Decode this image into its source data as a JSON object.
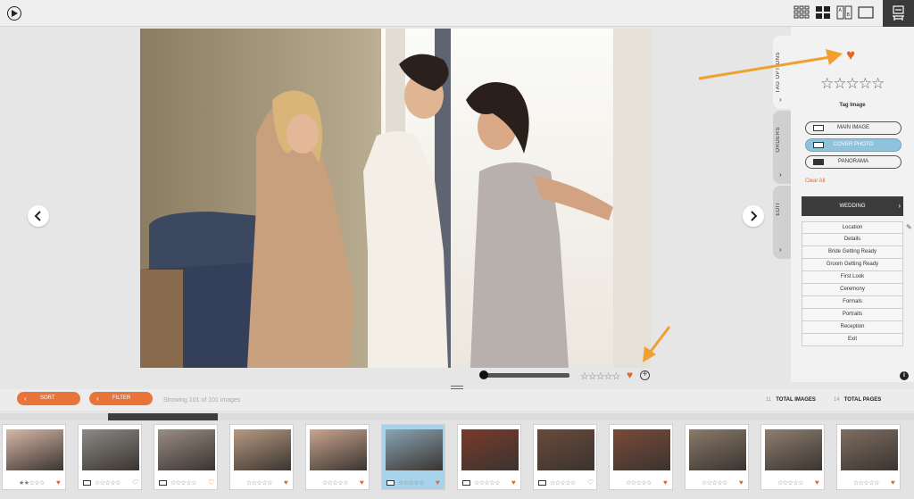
{
  "toolbar_top": {
    "play_icon": "play-circle-icon",
    "view_modes": [
      "grid-view-icon",
      "four-up-view-icon",
      "compare-ab-icon",
      "single-view-icon"
    ],
    "account_icon": "account-icon"
  },
  "main_image": {
    "rating_stars": 0,
    "favorited": true
  },
  "side_tabs": [
    {
      "label": "TAG OPTIONS",
      "active": true
    },
    {
      "label": "ORDERS",
      "active": false
    },
    {
      "label": "EDIT",
      "active": false
    }
  ],
  "tag_panel": {
    "tag_label": "Tag Image",
    "buttons": [
      {
        "label": "MAIN IMAGE",
        "selected": false
      },
      {
        "label": "COVER PHOTO",
        "selected": true
      },
      {
        "label": "PANORAMA",
        "selected": false
      }
    ],
    "clear_all": "Clear All",
    "category": "WEDDING",
    "subcategories": [
      "Location",
      "Details",
      "Bride Getting Ready",
      "Groom Getting Ready",
      "First Look",
      "Ceremony",
      "Formals",
      "Portraits",
      "Reception",
      "Exit"
    ]
  },
  "bottom_toolbar": {
    "sort_label": "SORT",
    "filter_label": "FILTER",
    "showing_text": "Showing 101 of 101 images",
    "total_images_count": "11",
    "total_images_label": "TOTAL IMAGES",
    "total_pages_count": "14",
    "total_pages_label": "TOTAL PAGES"
  },
  "colors": {
    "accent": "#e8743a",
    "selected_blue": "#8fc3dc",
    "heart": "#e0662c"
  },
  "filmstrip": [
    {
      "stars": 2,
      "fav": true,
      "book": false,
      "selected": false
    },
    {
      "stars": 0,
      "fav": false,
      "book": true,
      "selected": false
    },
    {
      "stars": 0,
      "fav": false,
      "book": true,
      "selected": false
    },
    {
      "stars": 0,
      "fav": true,
      "book": false,
      "selected": false
    },
    {
      "stars": 0,
      "fav": true,
      "book": false,
      "selected": false
    },
    {
      "stars": 0,
      "fav": true,
      "book": true,
      "selected": true
    },
    {
      "stars": 0,
      "fav": true,
      "book": true,
      "selected": false
    },
    {
      "stars": 0,
      "fav": false,
      "book": true,
      "selected": false
    },
    {
      "stars": 0,
      "fav": true,
      "book": false,
      "selected": false
    },
    {
      "stars": 0,
      "fav": true,
      "book": false,
      "selected": false
    },
    {
      "stars": 0,
      "fav": true,
      "book": false,
      "selected": false
    },
    {
      "stars": 0,
      "fav": true,
      "book": false,
      "selected": false
    }
  ]
}
